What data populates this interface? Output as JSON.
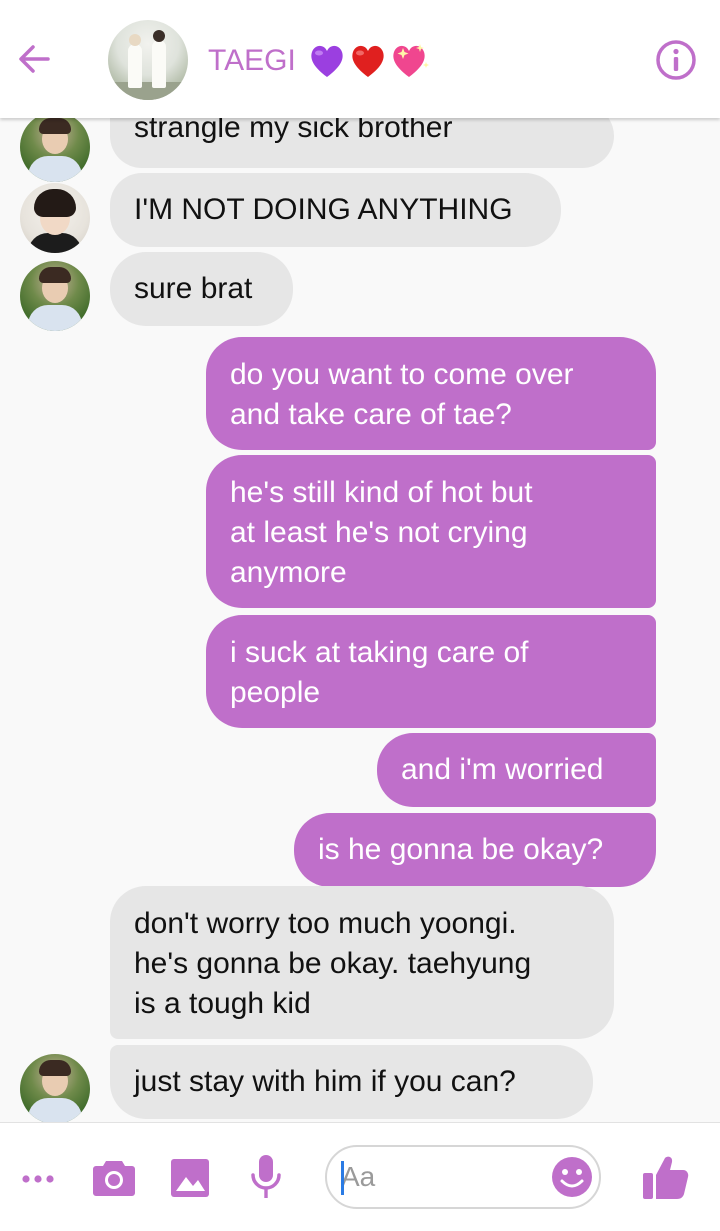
{
  "header": {
    "title": "TAEGI",
    "title_emoji": [
      "purple-heart",
      "red-heart",
      "sparkling-heart"
    ]
  },
  "messages": [
    {
      "side": "in",
      "sender": "jin",
      "text": "strangle my sick brother"
    },
    {
      "side": "in",
      "sender": "jungkook",
      "text": "I'M NOT DOING ANYTHING"
    },
    {
      "side": "in",
      "sender": "jin",
      "text": "sure brat"
    },
    {
      "side": "out",
      "text": "do you want to come over\nand take care of tae?"
    },
    {
      "side": "out",
      "text": "he's still kind of hot but\nat least he's not crying\nanymore"
    },
    {
      "side": "out",
      "text": "i suck at taking care of\npeople"
    },
    {
      "side": "out",
      "text": "and i'm worried"
    },
    {
      "side": "out",
      "text": "is he gonna be okay?"
    },
    {
      "side": "in",
      "sender": "jin",
      "text": "don't worry too much yoongi.\nhe's gonna be okay. taehyung\nis a tough kid"
    },
    {
      "side": "in",
      "sender": "jin",
      "text": "just stay with him if you can?"
    }
  ],
  "composer": {
    "placeholder": "Aa"
  },
  "toolbar_icons": [
    "more-icon",
    "camera-icon",
    "gallery-icon",
    "microphone-icon",
    "emoji-icon",
    "thumbs-up-icon"
  ],
  "colors": {
    "accent": "#bf6fca",
    "incoming_bubble": "#e6e6e6",
    "background": "#f9f9f9"
  }
}
